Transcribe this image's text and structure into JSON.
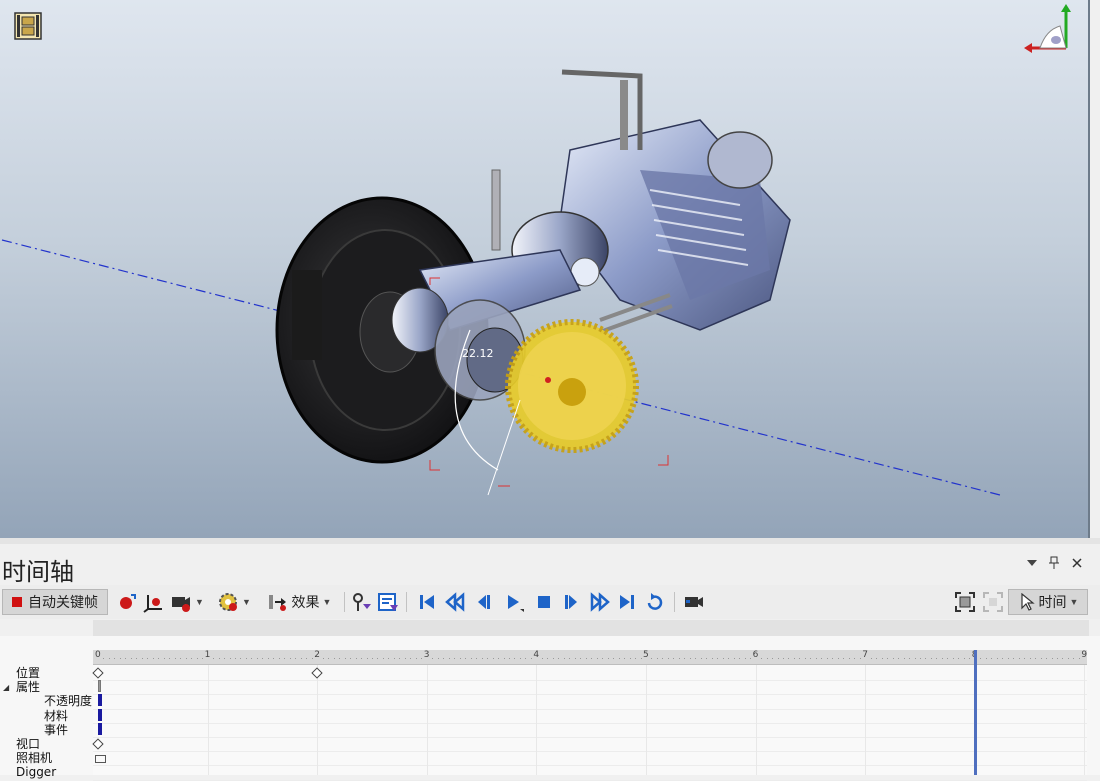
{
  "viewport": {
    "dimension_label": "22.12",
    "icons": [
      "film-clip-icon",
      "view-triad-icon"
    ]
  },
  "timeline": {
    "title": "时间轴",
    "header_controls": [
      "dropdown-arrow-icon",
      "pin-icon",
      "close-icon"
    ],
    "toolbar": {
      "auto_keyframe_label": "自动关键帧",
      "effects_label": "效果",
      "time_label": "时间"
    },
    "ruler_ticks": [
      "0",
      "1",
      "2",
      "3",
      "4",
      "5",
      "6",
      "7",
      "8",
      "9"
    ],
    "playhead_time": 8,
    "tracks": [
      {
        "label": "位置",
        "level": 0
      },
      {
        "label": "属性",
        "level": 0,
        "expanded": true
      },
      {
        "label": "不透明度",
        "level": 1
      },
      {
        "label": "材料",
        "level": 1
      },
      {
        "label": "事件",
        "level": 1
      },
      {
        "label": "视口",
        "level": 0
      },
      {
        "label": "照相机",
        "level": 0
      },
      {
        "label": "Digger",
        "level": 0
      }
    ],
    "keyframes": [
      {
        "track": "位置",
        "time": 0
      },
      {
        "track": "位置",
        "time": 2
      },
      {
        "track": "视口",
        "time": 0
      }
    ]
  },
  "colors": {
    "accent_blue": "#1e64c8",
    "record_red": "#d01010",
    "playhead": "#4f6fbf",
    "gear_yellow": "#e8cc2a"
  }
}
